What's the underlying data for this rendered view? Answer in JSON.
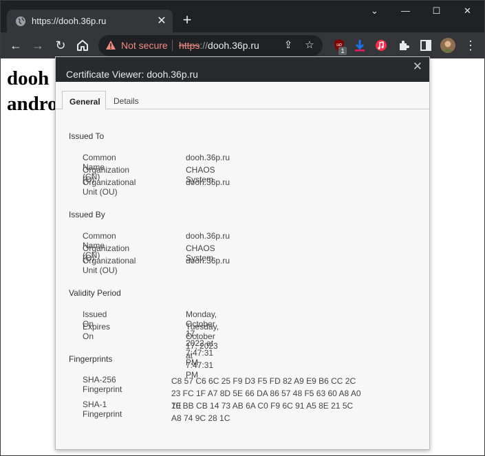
{
  "browser": {
    "tab_title": "https://dooh.36p.ru",
    "tab_close": "✕",
    "new_tab": "+",
    "window_controls": {
      "minimize": "—",
      "maximize": "☐",
      "close": "✕",
      "menu": "⌄"
    },
    "security_label": "Not secure",
    "url": {
      "scheme": "https",
      "separator": "://",
      "host": "dooh.36p.ru"
    },
    "extension_badge": "1"
  },
  "page": {
    "heading_line1": "dooh",
    "heading_line2": "andro"
  },
  "dialog": {
    "title": "Certificate Viewer: dooh.36p.ru",
    "close": "✕",
    "tabs": [
      {
        "label": "General"
      },
      {
        "label": "Details"
      }
    ],
    "issued_to": {
      "heading": "Issued To",
      "rows": [
        {
          "label": "Common Name (CN)",
          "value": "dooh.36p.ru"
        },
        {
          "label": "Organization (O)",
          "value": "CHAOS System"
        },
        {
          "label": "Organizational Unit (OU)",
          "value": "dooh.36p.ru"
        }
      ]
    },
    "issued_by": {
      "heading": "Issued By",
      "rows": [
        {
          "label": "Common Name (CN)",
          "value": "dooh.36p.ru"
        },
        {
          "label": "Organization (O)",
          "value": "CHAOS System"
        },
        {
          "label": "Organizational Unit (OU)",
          "value": "dooh.36p.ru"
        }
      ]
    },
    "validity": {
      "heading": "Validity Period",
      "rows": [
        {
          "label": "Issued On",
          "value": "Monday, October 17, 2022 at 7:47:31 PM"
        },
        {
          "label": "Expires On",
          "value": "Tuesday, October 17, 2023 at 7:47:31 PM"
        }
      ]
    },
    "fingerprints": {
      "heading": "Fingerprints",
      "rows": [
        {
          "label": "SHA-256 Fingerprint",
          "value": "C8 57 C6 6C 25 F9 D3 F5 FD 82 A9 E9 B6 CC 2C 23 FC 1F A7 8D 5E 66 DA 86 57 48 F5 63 60 A8 A0 1E"
        },
        {
          "label": "SHA-1 Fingerprint",
          "value": "70 BB CB 14 73 AB 6A C0 F9 6C 91 A5 8E 21 5C A8 74 9C 28 1C"
        }
      ]
    }
  },
  "colors": {
    "titlebar": "#202124",
    "toolbar": "#35363a",
    "insecure": "#f28b82",
    "dialog_header": "#292a2d"
  }
}
